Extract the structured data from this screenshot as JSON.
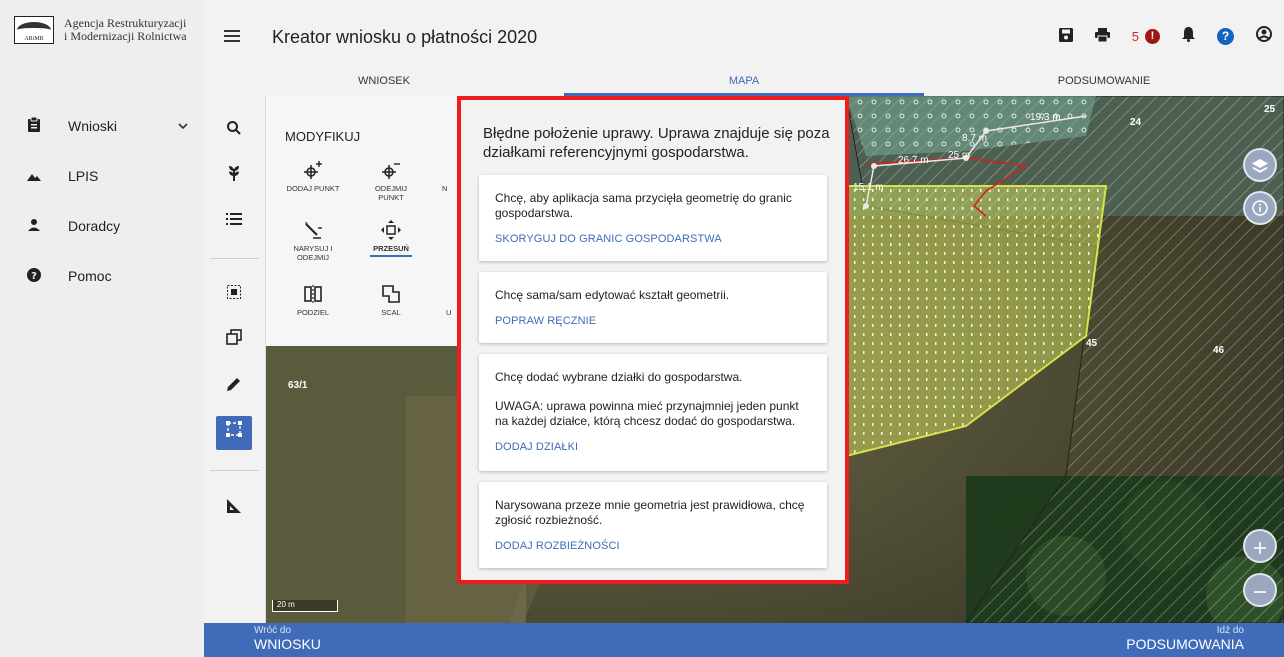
{
  "app": {
    "logo_line1": "Agencja Restrukturyzacji",
    "logo_line2": "i Modernizacji Rolnictwa",
    "title": "Kreator wniosku o płatności 2020",
    "notification_count": "5",
    "alert_glyph": "!",
    "help_glyph": "?"
  },
  "sidebar": {
    "items": [
      {
        "label": "Wnioski",
        "icon": "clipboard-icon"
      },
      {
        "label": "LPIS",
        "icon": "mountain-icon"
      },
      {
        "label": "Doradcy",
        "icon": "person-icon"
      },
      {
        "label": "Pomoc",
        "icon": "help-icon"
      }
    ]
  },
  "tabs": [
    {
      "label": "WNIOSEK",
      "active": false
    },
    {
      "label": "MAPA",
      "active": true
    },
    {
      "label": "PODSUMOWANIE",
      "active": false
    }
  ],
  "modify": {
    "title": "MODYFIKUJ",
    "buttons": {
      "add_point": "DODAJ PUNKT",
      "remove_point": "ODEJMIJ PUNKT",
      "draw_remove": "NARYSUJ I ODEJMIJ",
      "move": "PRZESUŃ",
      "split": "PODZIEL",
      "merge": "SCAL"
    },
    "clipped": [
      "N",
      "U"
    ]
  },
  "map": {
    "plot_labels": [
      "63/1",
      "24",
      "25",
      "45",
      "46"
    ],
    "measure_labels": [
      "8.7 m",
      "19.3 m",
      "15.1 m",
      "26.7 m",
      "25 m"
    ],
    "scale_label": "20 m"
  },
  "modal": {
    "title": "Błędne położenie uprawy. Uprawa znajduje się poza działkami referencyjnymi gospodarstwa.",
    "options": [
      {
        "text": "Chcę, aby aplikacja sama przycięła geometrię do granic gospodarstwa.",
        "action": "SKORYGUJ DO GRANIC GOSPODARSTWA"
      },
      {
        "text": "Chcę sama/sam edytować kształt geometrii.",
        "action": "POPRAW RĘCZNIE"
      },
      {
        "text": "Chcę dodać wybrane działki do gospodarstwa.",
        "note": "UWAGA: uprawa powinna mieć przynajmniej jeden punkt na każdej działce, którą chcesz dodać do gospodarstwa.",
        "action": "DODAJ DZIAŁKI"
      },
      {
        "text": "Narysowana przeze mnie geometria jest prawidłowa, chcę zgłosić rozbieżność.",
        "action": "DODAJ ROZBIEŻNOŚCI"
      }
    ]
  },
  "bottom": {
    "back_small": "Wróć do",
    "back_big": "WNIOSKU",
    "next_small": "Idź do",
    "next_big": "PODSUMOWANIA"
  },
  "colors": {
    "accent": "#3f6bb8",
    "modal_border": "#ee1c1c",
    "alert": "#a01515",
    "parcel_fill": "#c9d65a"
  }
}
